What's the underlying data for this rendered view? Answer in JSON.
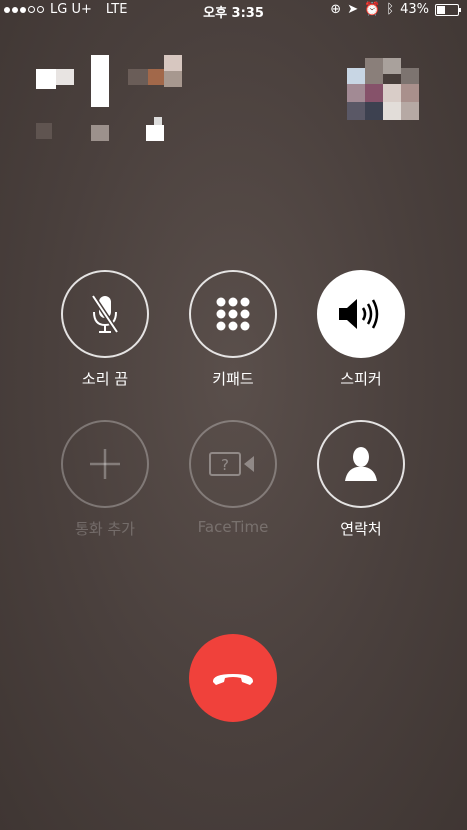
{
  "status_bar": {
    "carrier": "LG U+",
    "network": "LTE",
    "time": "오후 3:35",
    "battery_percent": "43%",
    "battery_level": 0.43
  },
  "controls": [
    {
      "label": "소리 끔",
      "icon": "mic-muted-icon",
      "enabled": true
    },
    {
      "label": "키패드",
      "icon": "keypad-icon",
      "enabled": true
    },
    {
      "label": "스피커",
      "icon": "speaker-icon",
      "enabled": true,
      "active": true
    },
    {
      "label": "통화 추가",
      "icon": "plus-icon",
      "enabled": false
    },
    {
      "label": "FaceTime",
      "icon": "facetime-icon",
      "enabled": false
    },
    {
      "label": "연락처",
      "icon": "contact-icon",
      "enabled": true
    }
  ],
  "end_call": {
    "icon": "phone-hangup-icon",
    "color": "#f0413b"
  }
}
